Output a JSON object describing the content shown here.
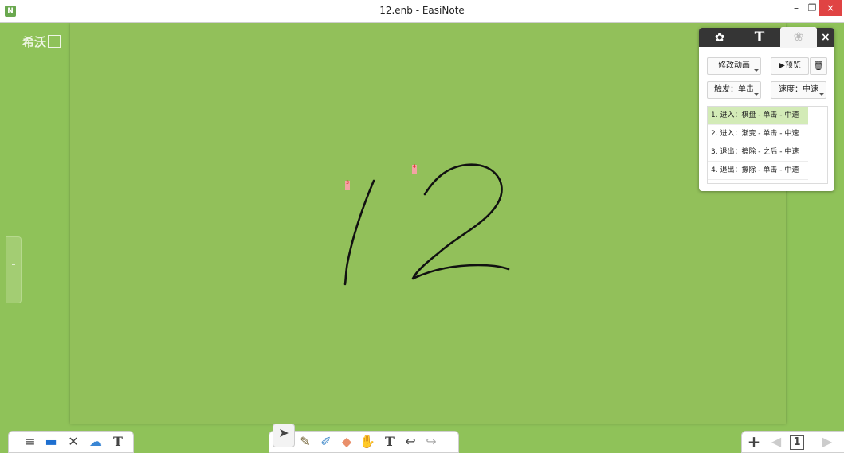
{
  "window": {
    "title": "12.enb - EasiNote",
    "app_icon_letter": "N",
    "controls": {
      "minimize": "–",
      "maximize": "❐",
      "close": "×"
    }
  },
  "brand": {
    "logo_text": "希沃"
  },
  "panel": {
    "tabs": [
      {
        "name": "settings",
        "icon": "gear-icon"
      },
      {
        "name": "text",
        "label": "T"
      },
      {
        "name": "animation",
        "icon": "flower-icon"
      }
    ],
    "close_label": "×",
    "buttons": {
      "modify_animation": "修改动画",
      "preview": "▶预览",
      "delete_icon": "🗑",
      "trigger": "触发：单击",
      "speed": "速度：中速"
    },
    "animations": [
      "1. 进入：棋盘 - 单击 - 中速",
      "2. 进入：渐变 - 单击 - 中速",
      "3. 退出：擦除 - 之后 - 中速",
      "4. 退出：擦除 - 单击 - 中速"
    ]
  },
  "anim_markers": {
    "first": "3",
    "second": "4"
  },
  "toolbar_left": {
    "items": [
      {
        "name": "menu-icon",
        "glyph": "≡"
      },
      {
        "name": "display-icon",
        "glyph": "▬"
      },
      {
        "name": "tools-icon",
        "glyph": "✕"
      },
      {
        "name": "cloud-icon",
        "glyph": "☁"
      },
      {
        "name": "text-recognize-icon",
        "glyph": "T"
      }
    ]
  },
  "toolbar_center": {
    "items": [
      {
        "name": "select-icon",
        "glyph": "➤"
      },
      {
        "name": "pen-icon",
        "glyph": "✎"
      },
      {
        "name": "brush-icon",
        "glyph": "✐"
      },
      {
        "name": "eraser-icon",
        "glyph": "◆"
      },
      {
        "name": "hand-icon",
        "glyph": "✋"
      },
      {
        "name": "text-icon",
        "glyph": "T"
      },
      {
        "name": "undo-icon",
        "glyph": "↩"
      },
      {
        "name": "redo-icon",
        "glyph": "↪"
      }
    ]
  },
  "toolbar_right": {
    "add": "+",
    "prev": "◀",
    "page_number": "1",
    "next": "▶"
  }
}
